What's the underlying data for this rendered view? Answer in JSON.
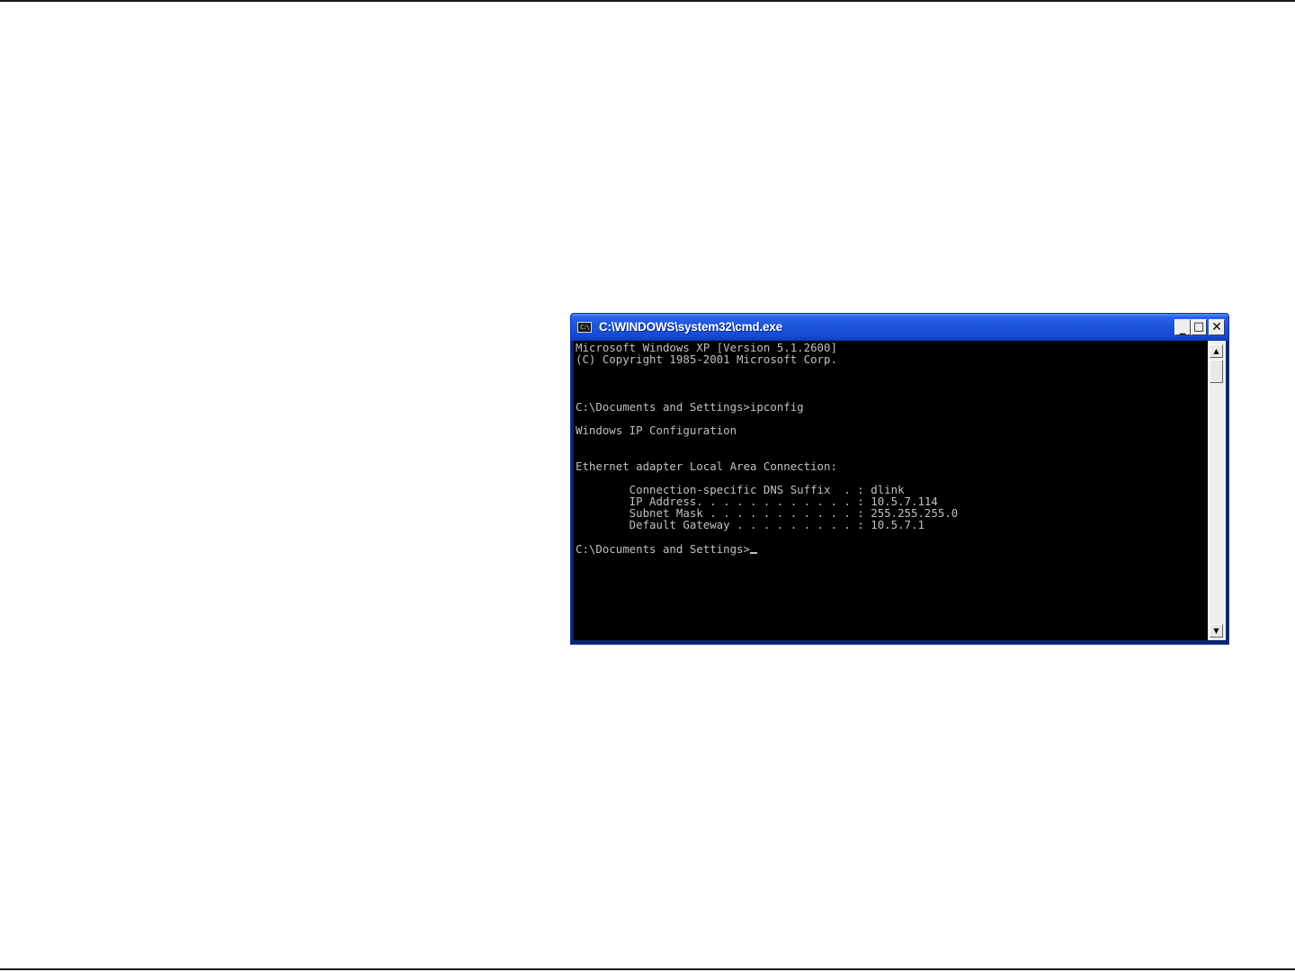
{
  "window": {
    "title": "C:\\WINDOWS\\system32\\cmd.exe",
    "icon": "cmd-prompt-icon",
    "icon_glyph": "C:\\",
    "buttons": {
      "minimize": "minimize-icon",
      "maximize": "maximize-icon",
      "close": "close-icon"
    }
  },
  "console": {
    "lines": [
      "Microsoft Windows XP [Version 5.1.2600]",
      "(C) Copyright 1985-2001 Microsoft Corp.",
      "C:\\Documents and Settings>ipconfig",
      "Windows IP Configuration",
      "Ethernet adapter Local Area Connection:",
      "        Connection-specific DNS Suffix  . : dlink",
      "        IP Address. . . . . . . . . . . . : 10.5.7.114",
      "        Subnet Mask . . . . . . . . . . . : 255.255.255.0",
      "        Default Gateway . . . . . . . . . : 10.5.7.1",
      "C:\\Documents and Settings>"
    ]
  },
  "scrollbar": {
    "up": "scroll-up-arrow-icon",
    "down": "scroll-down-arrow-icon",
    "position": 0
  },
  "colors": {
    "titlebar": "#2a63e6",
    "console_bg": "#000000",
    "console_text": "#c0c0c0"
  }
}
